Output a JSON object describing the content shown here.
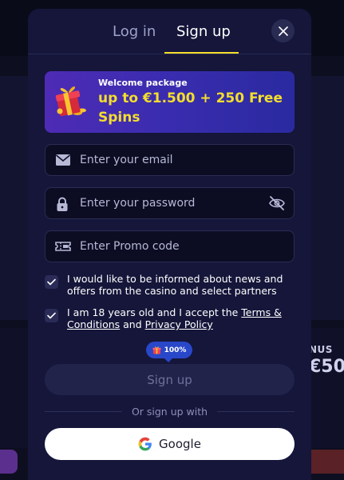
{
  "tabs": {
    "login": "Log in",
    "signup": "Sign up",
    "active": "signup"
  },
  "welcome": {
    "title": "Welcome package",
    "offer": "up to €1.500 + 250 Free Spins"
  },
  "fields": {
    "email": {
      "placeholder": "Enter your email",
      "value": ""
    },
    "password": {
      "placeholder": "Enter your password",
      "value": ""
    },
    "promo": {
      "placeholder": "Enter Promo code",
      "value": ""
    }
  },
  "checkboxes": {
    "news": {
      "checked": true,
      "text": "I would like to be informed about news and offers from the casino and select partners"
    },
    "age": {
      "checked": true,
      "text_before": "I am 18 years old and I accept the ",
      "terms_link": "Terms & Conditions",
      "text_between": " and ",
      "privacy_link": "Privacy Policy"
    }
  },
  "badge": {
    "text": "100%"
  },
  "signup_button": "Sign up",
  "or_text": "Or sign up with",
  "google_button": "Google",
  "background": {
    "bonus_label": "NUS",
    "bonus_value": "€50"
  },
  "icons": {
    "close": "close-icon",
    "gift": "gift-icon",
    "email": "mail-icon",
    "password": "lock-icon",
    "toggle_visibility": "eye-off-icon",
    "promo": "ticket-icon",
    "checkbox": "check-icon",
    "google": "google-icon"
  },
  "colors": {
    "modal_bg": "#15163a",
    "accent_yellow": "#f3de2d",
    "field_bg": "#0c0d23",
    "badge_blue": "#2947c9",
    "button_disabled": "#22234a"
  }
}
